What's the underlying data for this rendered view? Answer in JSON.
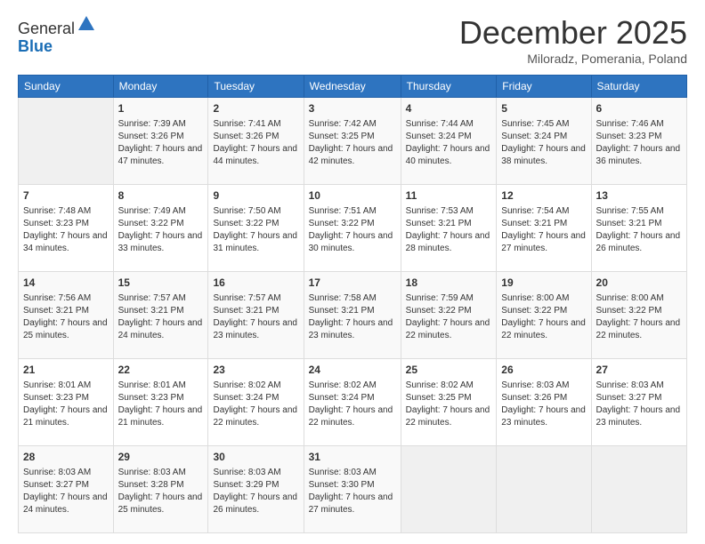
{
  "header": {
    "logo_line1": "General",
    "logo_line2": "Blue",
    "month_title": "December 2025",
    "location": "Miloradz, Pomerania, Poland"
  },
  "weekdays": [
    "Sunday",
    "Monday",
    "Tuesday",
    "Wednesday",
    "Thursday",
    "Friday",
    "Saturday"
  ],
  "weeks": [
    [
      {
        "day": null
      },
      {
        "day": "1",
        "sunrise": "7:39 AM",
        "sunset": "3:26 PM",
        "daylight": "7 hours and 47 minutes."
      },
      {
        "day": "2",
        "sunrise": "7:41 AM",
        "sunset": "3:26 PM",
        "daylight": "7 hours and 44 minutes."
      },
      {
        "day": "3",
        "sunrise": "7:42 AM",
        "sunset": "3:25 PM",
        "daylight": "7 hours and 42 minutes."
      },
      {
        "day": "4",
        "sunrise": "7:44 AM",
        "sunset": "3:24 PM",
        "daylight": "7 hours and 40 minutes."
      },
      {
        "day": "5",
        "sunrise": "7:45 AM",
        "sunset": "3:24 PM",
        "daylight": "7 hours and 38 minutes."
      },
      {
        "day": "6",
        "sunrise": "7:46 AM",
        "sunset": "3:23 PM",
        "daylight": "7 hours and 36 minutes."
      }
    ],
    [
      {
        "day": "7",
        "sunrise": "7:48 AM",
        "sunset": "3:23 PM",
        "daylight": "7 hours and 34 minutes."
      },
      {
        "day": "8",
        "sunrise": "7:49 AM",
        "sunset": "3:22 PM",
        "daylight": "7 hours and 33 minutes."
      },
      {
        "day": "9",
        "sunrise": "7:50 AM",
        "sunset": "3:22 PM",
        "daylight": "7 hours and 31 minutes."
      },
      {
        "day": "10",
        "sunrise": "7:51 AM",
        "sunset": "3:22 PM",
        "daylight": "7 hours and 30 minutes."
      },
      {
        "day": "11",
        "sunrise": "7:53 AM",
        "sunset": "3:21 PM",
        "daylight": "7 hours and 28 minutes."
      },
      {
        "day": "12",
        "sunrise": "7:54 AM",
        "sunset": "3:21 PM",
        "daylight": "7 hours and 27 minutes."
      },
      {
        "day": "13",
        "sunrise": "7:55 AM",
        "sunset": "3:21 PM",
        "daylight": "7 hours and 26 minutes."
      }
    ],
    [
      {
        "day": "14",
        "sunrise": "7:56 AM",
        "sunset": "3:21 PM",
        "daylight": "7 hours and 25 minutes."
      },
      {
        "day": "15",
        "sunrise": "7:57 AM",
        "sunset": "3:21 PM",
        "daylight": "7 hours and 24 minutes."
      },
      {
        "day": "16",
        "sunrise": "7:57 AM",
        "sunset": "3:21 PM",
        "daylight": "7 hours and 23 minutes."
      },
      {
        "day": "17",
        "sunrise": "7:58 AM",
        "sunset": "3:21 PM",
        "daylight": "7 hours and 23 minutes."
      },
      {
        "day": "18",
        "sunrise": "7:59 AM",
        "sunset": "3:22 PM",
        "daylight": "7 hours and 22 minutes."
      },
      {
        "day": "19",
        "sunrise": "8:00 AM",
        "sunset": "3:22 PM",
        "daylight": "7 hours and 22 minutes."
      },
      {
        "day": "20",
        "sunrise": "8:00 AM",
        "sunset": "3:22 PM",
        "daylight": "7 hours and 22 minutes."
      }
    ],
    [
      {
        "day": "21",
        "sunrise": "8:01 AM",
        "sunset": "3:23 PM",
        "daylight": "7 hours and 21 minutes."
      },
      {
        "day": "22",
        "sunrise": "8:01 AM",
        "sunset": "3:23 PM",
        "daylight": "7 hours and 21 minutes."
      },
      {
        "day": "23",
        "sunrise": "8:02 AM",
        "sunset": "3:24 PM",
        "daylight": "7 hours and 22 minutes."
      },
      {
        "day": "24",
        "sunrise": "8:02 AM",
        "sunset": "3:24 PM",
        "daylight": "7 hours and 22 minutes."
      },
      {
        "day": "25",
        "sunrise": "8:02 AM",
        "sunset": "3:25 PM",
        "daylight": "7 hours and 22 minutes."
      },
      {
        "day": "26",
        "sunrise": "8:03 AM",
        "sunset": "3:26 PM",
        "daylight": "7 hours and 23 minutes."
      },
      {
        "day": "27",
        "sunrise": "8:03 AM",
        "sunset": "3:27 PM",
        "daylight": "7 hours and 23 minutes."
      }
    ],
    [
      {
        "day": "28",
        "sunrise": "8:03 AM",
        "sunset": "3:27 PM",
        "daylight": "7 hours and 24 minutes."
      },
      {
        "day": "29",
        "sunrise": "8:03 AM",
        "sunset": "3:28 PM",
        "daylight": "7 hours and 25 minutes."
      },
      {
        "day": "30",
        "sunrise": "8:03 AM",
        "sunset": "3:29 PM",
        "daylight": "7 hours and 26 minutes."
      },
      {
        "day": "31",
        "sunrise": "8:03 AM",
        "sunset": "3:30 PM",
        "daylight": "7 hours and 27 minutes."
      },
      {
        "day": null
      },
      {
        "day": null
      },
      {
        "day": null
      }
    ]
  ]
}
